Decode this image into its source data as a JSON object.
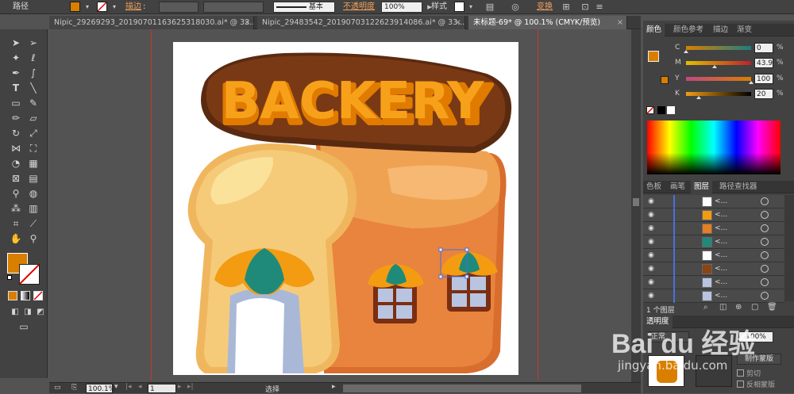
{
  "control_bar": {
    "object_label": "路径",
    "fill_color": "#d97f00",
    "stroke_label": "描边",
    "stroke_weight": ":",
    "stroke_style": "基本",
    "opacity_label": "不透明度",
    "opacity_value": "100%",
    "style_label": "样式",
    "transform_label": "变换"
  },
  "tabs": [
    {
      "label": "Nipic_29269293_20190701163625318030.ai* @ 33..."
    },
    {
      "label": "Nipic_29483542_20190703122623914086.ai* @ 33..."
    },
    {
      "label": "未标题-69* @ 100.1% (CMYK/预览)"
    }
  ],
  "artwork": {
    "sign_text": "BACKERY"
  },
  "status_bar": {
    "zoom": "100.1%",
    "page": "1",
    "mode": "选择"
  },
  "color_panel": {
    "tabs": [
      "颜色",
      "颜色参考",
      "描边",
      "渐变"
    ],
    "channels": [
      {
        "key": "C",
        "value": "0",
        "pct": "%",
        "level": 0.0
      },
      {
        "key": "M",
        "value": "43.93",
        "pct": "%",
        "level": 0.44
      },
      {
        "key": "Y",
        "value": "100",
        "pct": "%",
        "level": 1.0
      },
      {
        "key": "K",
        "value": "20",
        "pct": "%",
        "level": 0.2
      }
    ],
    "current_color": "#d97f00"
  },
  "layers_panel": {
    "tabs": [
      "色板",
      "画笔",
      "图层",
      "路径查找器"
    ],
    "rows": [
      {
        "name": "<...",
        "thumb_color": "#ffffff"
      },
      {
        "name": "<...",
        "thumb_color": "#f39c12"
      },
      {
        "name": "<...",
        "thumb_color": "#e67e22"
      },
      {
        "name": "<...",
        "thumb_color": "#1f8a7a"
      },
      {
        "name": "<...",
        "thumb_color": "#ffffff"
      },
      {
        "name": "<...",
        "thumb_color": "#8b4513"
      },
      {
        "name": "<...",
        "thumb_color": "#b8c4e0"
      },
      {
        "name": "<...",
        "thumb_color": "#b8c4e0"
      }
    ],
    "layer_count": "1 个图层"
  },
  "transparency_panel": {
    "title": "透明度",
    "mode": "正常",
    "opacity": "100%",
    "make_mask": "制作蒙版",
    "clip": "剪切",
    "invert_mask": "反相蒙版"
  },
  "watermark": {
    "brand": "Bai du 经验",
    "url": "jingyan.baidu.com"
  }
}
